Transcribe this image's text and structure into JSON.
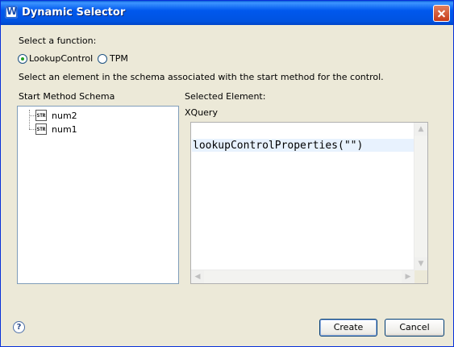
{
  "window": {
    "title": "Dynamic Selector"
  },
  "function_group": {
    "label": "Select a function:",
    "options": [
      {
        "label": "LookupControl",
        "selected": true
      },
      {
        "label": "TPM",
        "selected": false
      }
    ]
  },
  "instruction": "Select an element in the schema associated with the start method for the control.",
  "schema": {
    "label": "Start Method Schema",
    "items": [
      {
        "icon": "STR",
        "label": "num2"
      },
      {
        "icon": "STR",
        "label": "num1"
      }
    ]
  },
  "selected_element": {
    "label": "Selected Element:",
    "xquery_label": "XQuery",
    "xquery_value": "lookupControlProperties(\"\")"
  },
  "buttons": {
    "create": "Create",
    "cancel": "Cancel",
    "help": "?"
  }
}
